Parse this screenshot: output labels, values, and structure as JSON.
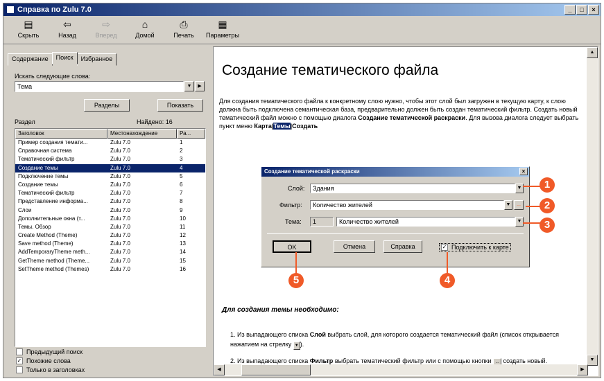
{
  "window": {
    "title": "Справка по Zulu 7.0",
    "controls": [
      "_",
      "□",
      "×"
    ]
  },
  "toolbar": [
    {
      "label": "Скрыть",
      "icon": "hide-icon",
      "glyph": "▤",
      "disabled": false
    },
    {
      "label": "Назад",
      "icon": "back-arrow-icon",
      "glyph": "⇦",
      "disabled": false
    },
    {
      "label": "Вперед",
      "icon": "forward-arrow-icon",
      "glyph": "⇨",
      "disabled": true
    },
    {
      "label": "Домой",
      "icon": "home-icon",
      "glyph": "⌂",
      "disabled": false
    },
    {
      "label": "Печать",
      "icon": "print-icon",
      "glyph": "⎙",
      "disabled": false
    },
    {
      "label": "Параметры",
      "icon": "options-icon",
      "glyph": "▦",
      "disabled": false
    }
  ],
  "nav": {
    "tabs": [
      "Содержание",
      "Поиск",
      "Избранное"
    ],
    "active_tab": 1,
    "keyword_label": "Искать следующие слова:",
    "keyword_value": "Тема",
    "sections_button": "Разделы",
    "show_button": "Показать",
    "section_label": "Раздел",
    "found_label": "Найдено: 16",
    "columns": [
      "Заголовок",
      "Местонахождение",
      "Ра..."
    ],
    "rows": [
      [
        "Пример создания темати...",
        "Zulu 7.0",
        "1"
      ],
      [
        "Справочная система",
        "Zulu 7.0",
        "2"
      ],
      [
        "Тематический фильтр",
        "Zulu 7.0",
        "3"
      ],
      [
        "Создание темы",
        "Zulu 7.0",
        "4"
      ],
      [
        "Подключение темы",
        "Zulu 7.0",
        "5"
      ],
      [
        "Создание темы",
        "Zulu 7.0",
        "6"
      ],
      [
        "Тематический фильтр",
        "Zulu 7.0",
        "7"
      ],
      [
        "Представление информа...",
        "Zulu 7.0",
        "8"
      ],
      [
        "Слои",
        "Zulu 7.0",
        "9"
      ],
      [
        "Дополнительные окна (т...",
        "Zulu 7.0",
        "10"
      ],
      [
        "Темы. Обзор",
        "Zulu 7.0",
        "11"
      ],
      [
        "Create Method (Theme)",
        "Zulu 7.0",
        "12"
      ],
      [
        "Save method (Theme)",
        "Zulu 7.0",
        "13"
      ],
      [
        "AddTemporaryTheme meth...",
        "Zulu 7.0",
        "14"
      ],
      [
        "GetTheme method (Theme...",
        "Zulu 7.0",
        "15"
      ],
      [
        "SetTheme method (Themes)",
        "Zulu 7.0",
        "16"
      ]
    ],
    "selected_row": 3,
    "options": [
      {
        "label": "Предыдущий поиск",
        "checked": false
      },
      {
        "label": "Похожие слова",
        "checked": true
      },
      {
        "label": "Только в заголовках",
        "checked": false
      }
    ]
  },
  "topic": {
    "title": "Создание тематического файла",
    "para1": "Для создания тематического файла к конкретному слою нужно, чтобы этот слой был загружен в текущую карту, к слою должна быть подключена семантическая база, предварительно должен быть создан тематический фильтр. Создать новый тематический файл можно с помощью диалога ",
    "para1_bold": "Создание тематической раскраски",
    "para1_end": ". Для вызова диалога следует выбрать пункт меню ",
    "menu_path_a": "Карта|",
    "menu_path_b": "Темы",
    "menu_path_c": "|Создать",
    "section_heading": "Для создания темы необходимо:",
    "step1_num": "1.",
    "step1_a": "Из выпадающего списка ",
    "step1_b": "Слой",
    "step1_c": " выбрать слой, для которого создается тематический файл (список открывается нажатием на стрелку ",
    "step1_d": ").",
    "step2_num": "2.",
    "step2_a": "Из выпадающего списка ",
    "step2_b": "Фильтр",
    "step2_c": " выбрать тематический фильтр или с помощью кнопки ",
    "step2_d": " создать новый."
  },
  "dialog": {
    "title": "Создание тематической раскраски",
    "layer_label": "Слой:",
    "layer_value": "Здания",
    "filter_label": "Фильтр:",
    "filter_value": "Количество жителей",
    "theme_label": "Тема:",
    "theme_number": "1",
    "theme_value": "Количество жителей",
    "ok": "OK",
    "cancel": "Отмена",
    "help": "Справка",
    "connect_label": "Подключить к карте",
    "connect_checked": true
  },
  "callouts": [
    "1",
    "2",
    "3",
    "4",
    "5"
  ],
  "colors": {
    "accent": "#f05a28",
    "selection": "#0a246a",
    "face": "#d4d0c8"
  }
}
